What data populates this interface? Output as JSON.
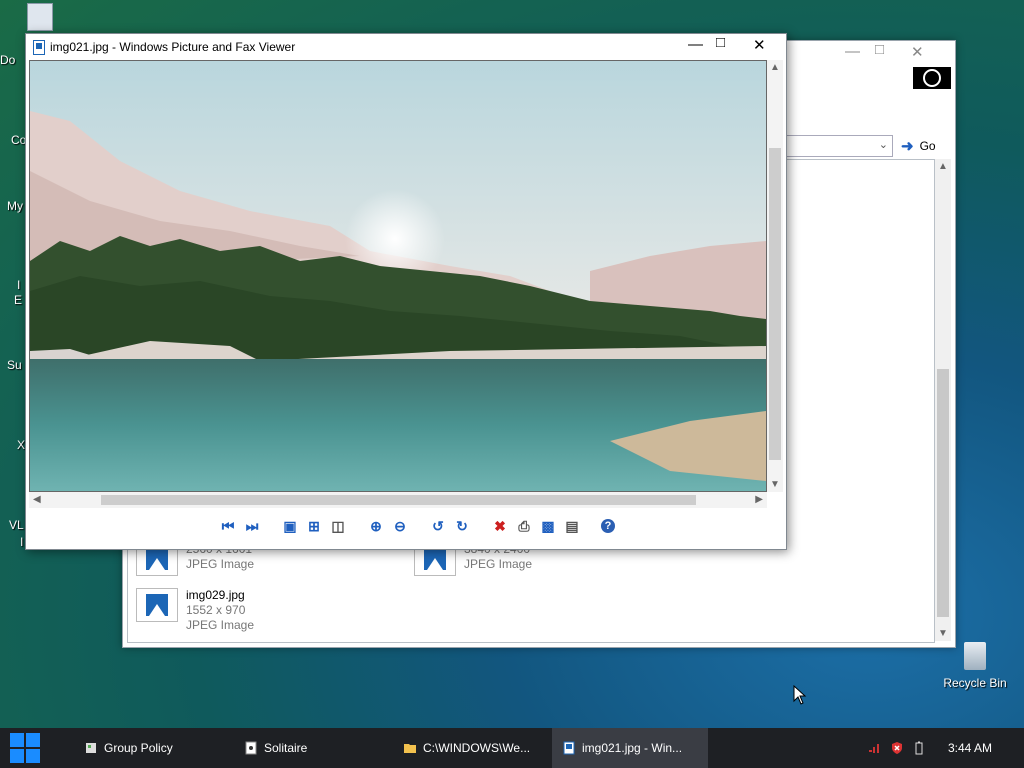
{
  "desktop": {
    "partial_labels": [
      "Do",
      "Co",
      "My",
      "I",
      "E",
      "Su",
      "X",
      "VL",
      "I"
    ]
  },
  "explorer": {
    "go_label": "Go",
    "files": [
      {
        "name": "",
        "dimensions": "2560 x 1601",
        "type": "JPEG Image"
      },
      {
        "name": "",
        "dimensions": "3840 x 2400",
        "type": "JPEG Image"
      },
      {
        "name": "img029.jpg",
        "dimensions": "1552 x 970",
        "type": "JPEG Image"
      }
    ]
  },
  "viewer": {
    "title": "img021.jpg - Windows Picture and Fax Viewer",
    "toolbar": [
      "previous-image",
      "next-image",
      "best-fit",
      "actual-size",
      "slideshow",
      "zoom-in",
      "zoom-out",
      "rotate-counterclockwise",
      "rotate-clockwise",
      "delete",
      "print",
      "save",
      "open-with",
      "help"
    ]
  },
  "recycle_bin": {
    "label": "Recycle Bin"
  },
  "taskbar": {
    "items": [
      {
        "label": "Group Policy",
        "icon": "group-policy-icon",
        "active": false
      },
      {
        "label": "Solitaire",
        "icon": "solitaire-icon",
        "active": false
      },
      {
        "label": "C:\\WINDOWS\\We...",
        "icon": "folder-icon",
        "active": false
      },
      {
        "label": "img021.jpg - Win...",
        "icon": "picture-viewer-icon",
        "active": true
      }
    ],
    "clock": "3:44 AM"
  },
  "colors": {
    "accent": "#1f5fbf",
    "start": "#1a8cff",
    "taskbar": "#1e2024"
  }
}
